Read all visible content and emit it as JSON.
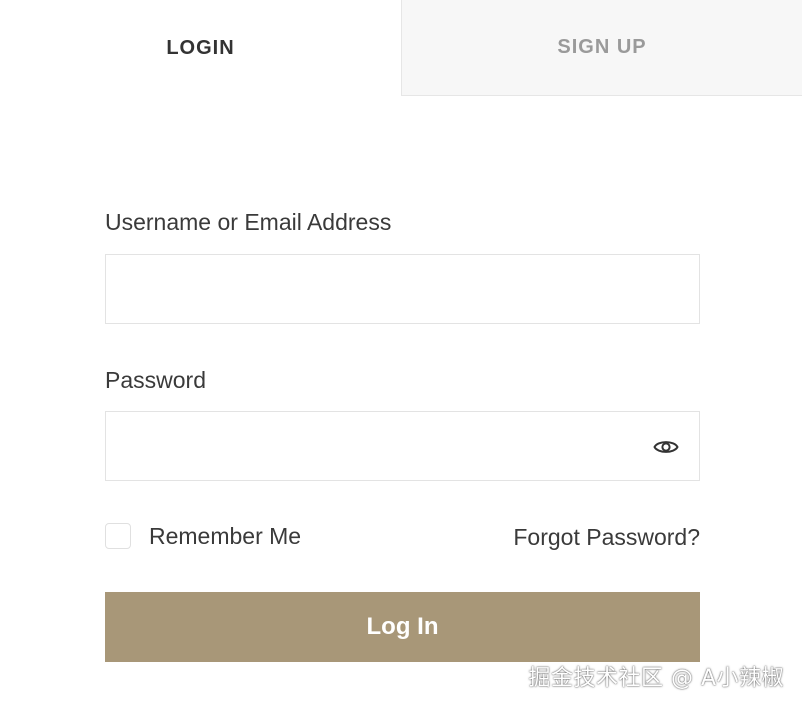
{
  "tabs": {
    "login_label": "LOGIN",
    "signup_label": "SIGN UP",
    "active": "login"
  },
  "form": {
    "username_label": "Username or Email Address",
    "username_value": "",
    "password_label": "Password",
    "password_value": "",
    "remember_label": "Remember Me",
    "remember_checked": false,
    "forgot_label": "Forgot Password?",
    "submit_label": "Log In"
  },
  "icons": {
    "password_toggle": "eye-icon"
  },
  "colors": {
    "button_bg": "#a89778",
    "button_text": "#ffffff",
    "active_tab_text": "#333333",
    "inactive_tab_text": "#9a9a9a",
    "inactive_tab_bg": "#f7f7f7"
  },
  "watermark": "掘金技术社区 @ A小辣椒"
}
